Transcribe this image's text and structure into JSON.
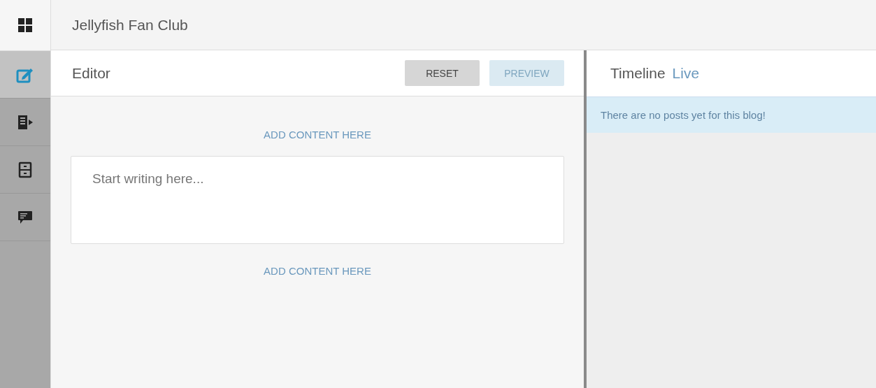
{
  "app": {
    "title": "Jellyfish Fan Club"
  },
  "sidebar": {
    "items": [
      {
        "kind": "edit",
        "selected": true
      },
      {
        "kind": "publish",
        "selected": false
      },
      {
        "kind": "archive",
        "selected": false
      },
      {
        "kind": "comments",
        "selected": false
      }
    ]
  },
  "editor": {
    "title": "Editor",
    "buttons": [
      {
        "label": "RESET",
        "disabled": false
      },
      {
        "label": "PREVIEW",
        "disabled": true
      }
    ],
    "add_content": [
      "ADD CONTENT HERE",
      "ADD CONTENT HERE"
    ],
    "text_field": {
      "placeholder": "Start writing here..."
    }
  },
  "timeline": {
    "title": "Timeline",
    "status": "Live",
    "message": "There are no posts yet for this blog!"
  }
}
